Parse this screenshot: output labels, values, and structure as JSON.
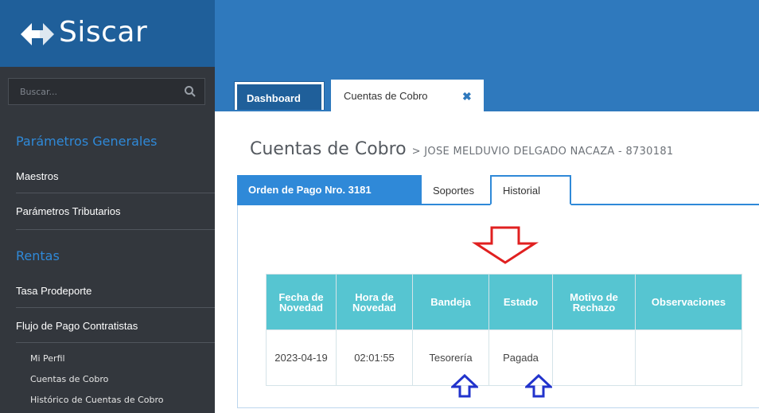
{
  "brand": {
    "name": "Siscar"
  },
  "sidebar": {
    "search_placeholder": "Buscar...",
    "sections": [
      {
        "title": "Parámetros Generales",
        "items": [
          "Maestros",
          "Parámetros Tributarios"
        ]
      },
      {
        "title": "Rentas",
        "items": [
          "Tasa Prodeporte",
          "Flujo de Pago Contratistas"
        ]
      }
    ],
    "sub_items": [
      "Mi Perfil",
      "Cuentas de Cobro",
      "Histórico de Cuentas de Cobro"
    ]
  },
  "tabs": {
    "dashboard": "Dashboard",
    "cuentas": "Cuentas de Cobro",
    "close_glyph": "✖"
  },
  "page": {
    "title": "Cuentas de Cobro",
    "subtitle": "> JOSE MELDUVIO DELGADO NACAZA - 8730181"
  },
  "subtabs": {
    "orden": "Orden de Pago Nro. 3181",
    "soportes": "Soportes",
    "historial": "Historial"
  },
  "history_table": {
    "headers": [
      "Fecha de Novedad",
      "Hora de Novedad",
      "Bandeja",
      "Estado",
      "Motivo de Rechazo",
      "Observaciones"
    ],
    "rows": [
      [
        "2023-04-19",
        "02:01:55",
        "Tesorería",
        "Pagada",
        "",
        ""
      ]
    ]
  },
  "colors": {
    "topbar": "#2f79bd",
    "sidebar": "#33373d",
    "accent": "#2f89d8",
    "table_header": "#56c5d1",
    "annotation_red": "#e02020",
    "annotation_blue": "#2233cc"
  },
  "icons": [
    "siscar-logo-icon",
    "search-icon",
    "close-icon",
    "red-down-arrow-icon",
    "blue-up-arrow-icon"
  ]
}
